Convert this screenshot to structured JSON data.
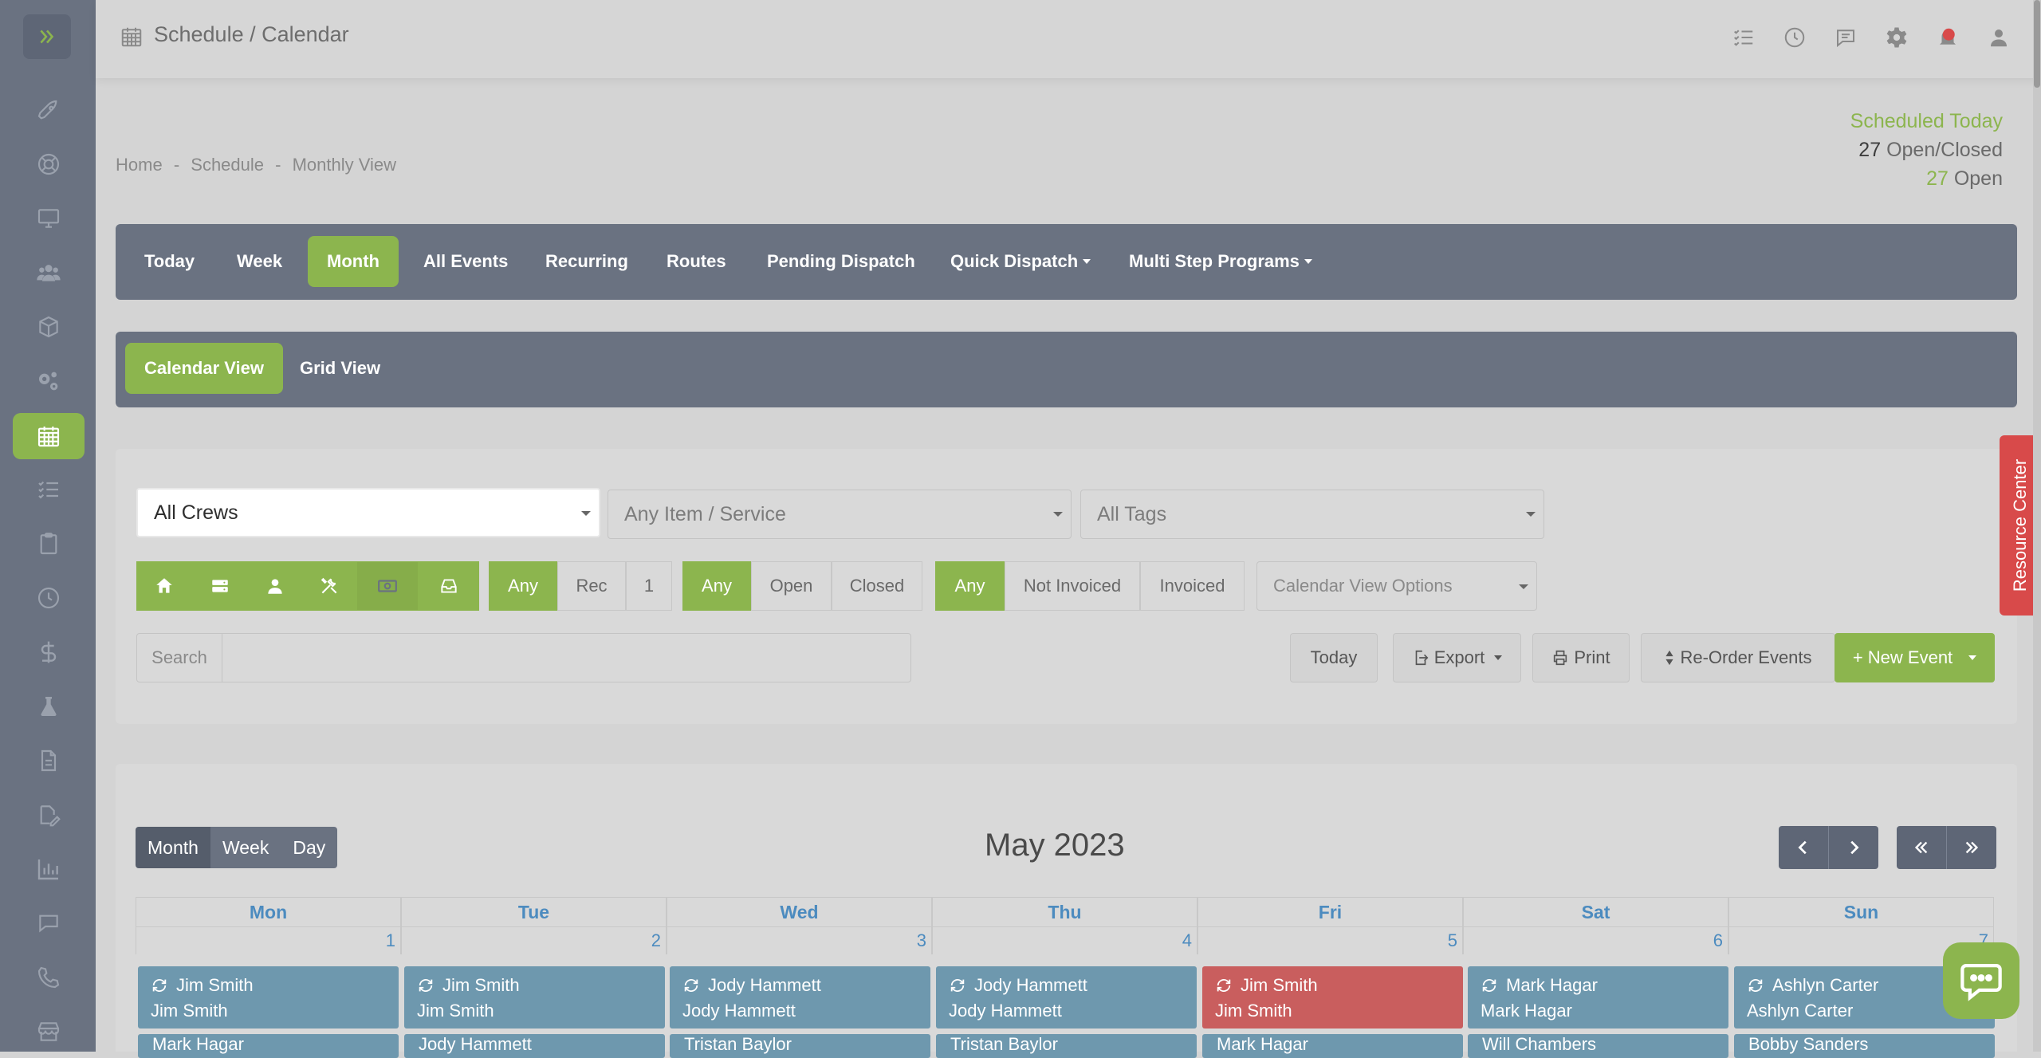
{
  "app": {
    "title": "Schedule / Calendar"
  },
  "breadcrumb": [
    "Home",
    "Schedule",
    "Monthly View"
  ],
  "breadcrumb_sep": "-",
  "scheduled_today": {
    "heading": "Scheduled Today",
    "open_closed_count": "27",
    "open_closed_label": "Open/Closed",
    "open_count": "27",
    "open_label": "Open"
  },
  "main_nav": [
    {
      "label": "Today"
    },
    {
      "label": "Week"
    },
    {
      "label": "Month",
      "active": true
    },
    {
      "label": "All Events"
    },
    {
      "label": "Recurring"
    },
    {
      "label": "Routes"
    },
    {
      "label": "Pending Dispatch"
    },
    {
      "label": "Quick Dispatch",
      "dropdown": true
    },
    {
      "label": "Multi Step Programs",
      "dropdown": true
    }
  ],
  "view_tabs": [
    {
      "label": "Calendar View",
      "active": true
    },
    {
      "label": "Grid View"
    }
  ],
  "filters": {
    "crews": "All Crews",
    "items": "Any Item / Service",
    "tags": "All Tags",
    "calendar_options": "Calendar View Options"
  },
  "recurrence_filter": [
    "Any",
    "Rec",
    "1"
  ],
  "status_filter": [
    "Any",
    "Open",
    "Closed"
  ],
  "invoice_filter": [
    "Any",
    "Not Invoiced",
    "Invoiced"
  ],
  "type_icons": [
    "home-icon",
    "server-icon",
    "user-icon",
    "tools-icon",
    "money-icon",
    "inbox-icon"
  ],
  "search": {
    "label": "Search",
    "value": ""
  },
  "actions": {
    "today": "Today",
    "export": "Export",
    "print": "Print",
    "reorder": "Re-Order Events",
    "new_event": "+ New Event"
  },
  "calendar": {
    "modes": [
      "Month",
      "Week",
      "Day"
    ],
    "title": "May 2023",
    "days_of_week": [
      "Mon",
      "Tue",
      "Wed",
      "Thu",
      "Fri",
      "Sat",
      "Sun"
    ],
    "dates": [
      "1",
      "2",
      "3",
      "4",
      "5",
      "6",
      "7"
    ],
    "events": [
      {
        "title": "Jim Smith",
        "sub": "Jim Smith",
        "color": "#6e98ae"
      },
      {
        "title": "Jim Smith",
        "sub": "Jim Smith",
        "color": "#6e98ae"
      },
      {
        "title": "Jody Hammett",
        "sub": "Jody Hammett",
        "color": "#6e98ae"
      },
      {
        "title": "Jody Hammett",
        "sub": "Jody Hammett",
        "color": "#6e98ae"
      },
      {
        "title": "Jim Smith",
        "sub": "Jim Smith",
        "color": "#c95e5e"
      },
      {
        "title": "Mark Hagar",
        "sub": "Mark Hagar",
        "color": "#6e98ae"
      },
      {
        "title": "Ashlyn Carter",
        "sub": "Ashlyn Carter",
        "color": "#6e98ae"
      }
    ],
    "events_row2": [
      "Mark Hagar",
      "Jody Hammett",
      "Tristan Baylor",
      "Tristan Baylor",
      "Mark Hagar",
      "Will Chambers",
      "Bobby Sanders"
    ]
  },
  "resource_center": "Resource Center",
  "colors": {
    "accent": "#8cb54e",
    "nav_bg": "#6a7281",
    "event_blue": "#6e98ae",
    "event_red": "#c95e5e",
    "alert_red": "#d84a4a"
  }
}
